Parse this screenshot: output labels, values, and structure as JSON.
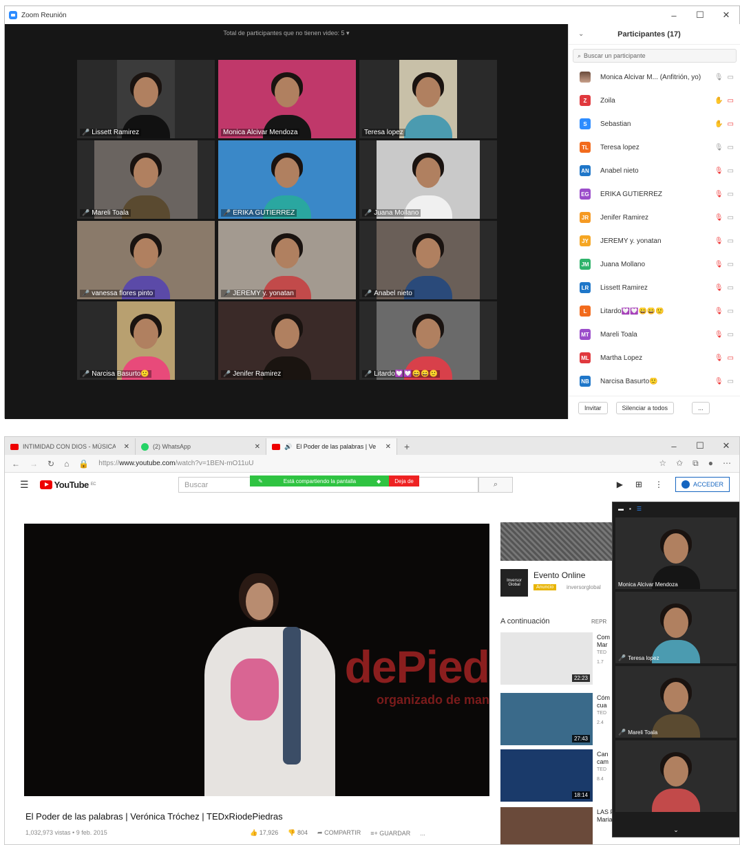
{
  "zoom": {
    "window_title": "Zoom Reunión",
    "window_buttons": [
      "–",
      "☐",
      "✕"
    ],
    "no_video_text": "Total de participantes que no tienen video: 5",
    "no_video_caret": "▾",
    "tiles": [
      {
        "name": "Lissett Ramirez",
        "muted": true,
        "bg": "#3b3b3b",
        "shirt": "#111"
      },
      {
        "name": "Monica Alcivar Mendoza",
        "muted": false,
        "active": true,
        "bg": "#c0386a",
        "shirt": "#151515"
      },
      {
        "name": "Teresa lopez",
        "muted": false,
        "bg": "#c8c0a8",
        "shirt": "#4b9bb0"
      },
      {
        "name": "Mareli Toala",
        "muted": true,
        "bg": "#6a6460",
        "shirt": "#5a4a30"
      },
      {
        "name": "ERIKA GUTIERREZ",
        "muted": true,
        "bg": "#3a88c8",
        "shirt": "#2aa7a0"
      },
      {
        "name": "Juana Mollano",
        "muted": true,
        "bg": "#c9c9c9",
        "shirt": "#f0f0f0"
      },
      {
        "name": "vanessa flores pinto",
        "muted": true,
        "bg": "#8a7a6a",
        "shirt": "#5b4aa8"
      },
      {
        "name": "JEREMY   y. yonatan",
        "muted": true,
        "bg": "#a39a90",
        "shirt": "#c24a4a"
      },
      {
        "name": "Anabel nieto",
        "muted": true,
        "bg": "#6a5f58",
        "shirt": "#2a4a7a"
      },
      {
        "name": "Narcisa Basurto🙂",
        "muted": true,
        "bg": "#b8a070",
        "shirt": "#e84a7a"
      },
      {
        "name": "Jenifer Ramirez",
        "muted": true,
        "bg": "#3a2a28",
        "shirt": "#1a1410"
      },
      {
        "name": "Litardo💟💟😄😄🙂",
        "muted": true,
        "bg": "#6a6a6a",
        "shirt": "#d8404a"
      }
    ],
    "participants": {
      "title": "Participantes (17)",
      "search_placeholder": "Buscar un participante",
      "list": [
        {
          "initials": "",
          "photo": true,
          "color": "#9a7a6a",
          "name": "Monica Alcivar M...  (Anfitrión, yo)",
          "mic": "gray",
          "cam": "gray"
        },
        {
          "initials": "Z",
          "color": "#e0393e",
          "name": "Zoila",
          "mic": "blue",
          "cam": "red"
        },
        {
          "initials": "S",
          "color": "#2d8cff",
          "name": "Sebastian",
          "mic": "blue",
          "cam": "red"
        },
        {
          "initials": "TL",
          "color": "#f26b1d",
          "name": "Teresa lopez",
          "mic": "gray",
          "cam": "gray"
        },
        {
          "initials": "AN",
          "color": "#1f77c9",
          "name": "Anabel nieto",
          "mic": "red",
          "cam": "gray"
        },
        {
          "initials": "EG",
          "color": "#9b4dca",
          "name": "ERIKA GUTIERREZ",
          "mic": "red",
          "cam": "gray"
        },
        {
          "initials": "JR",
          "color": "#f59a23",
          "name": "Jenifer Ramirez",
          "mic": "red",
          "cam": "gray"
        },
        {
          "initials": "JY",
          "color": "#f5a623",
          "name": "JEREMY   y. yonatan",
          "mic": "red",
          "cam": "gray"
        },
        {
          "initials": "JM",
          "color": "#2fb36b",
          "name": "Juana Mollano",
          "mic": "red",
          "cam": "gray"
        },
        {
          "initials": "LR",
          "color": "#1f77c9",
          "name": "Lissett Ramirez",
          "mic": "red",
          "cam": "gray"
        },
        {
          "initials": "L",
          "color": "#f26b1d",
          "name": "Litardo💟💟😄😄🙂",
          "mic": "red",
          "cam": "gray"
        },
        {
          "initials": "MT",
          "color": "#9b4dca",
          "name": "Mareli Toala",
          "mic": "red",
          "cam": "gray"
        },
        {
          "initials": "ML",
          "color": "#e0393e",
          "name": "Martha Lopez",
          "mic": "red",
          "cam": "red"
        },
        {
          "initials": "NB",
          "color": "#1f77c9",
          "name": "Narcisa Basurto🙂",
          "mic": "red",
          "cam": "gray"
        }
      ],
      "invite_label": "Invitar",
      "mute_all_label": "Silenciar a todos",
      "more_label": "..."
    }
  },
  "browser": {
    "tabs": [
      {
        "title": "INTIMIDAD CON DIOS - MÚSICA",
        "icon": "youtube-icon"
      },
      {
        "title": "(2) WhatsApp",
        "icon": "whatsapp-icon"
      },
      {
        "title": "El Poder de las palabras | Ve",
        "icon": "youtube-icon",
        "active": true
      }
    ],
    "new_tab": "+",
    "url_prefix": "https://",
    "url_domain": "www.youtube.com",
    "url_path": "/watch?v=1BEN-mO11uU",
    "window_buttons": [
      "–",
      "☐",
      "✕"
    ]
  },
  "youtube": {
    "logo_text": "YouTube",
    "logo_region": "EC",
    "search_placeholder": "Buscar",
    "share_text": "Está compartiendo la pantalla",
    "stop_share_text": "Deja de",
    "acceder_label": "ACCEDER",
    "stage_text": "dePied",
    "stage_sub": "organizado de man",
    "video_title": "El Poder de las palabras | Verónica Tróchez | TEDxRiodePiedras",
    "video_stats": "1,032,973 vistas • 9 feb. 2015",
    "likes": "17,926",
    "dislikes": "804",
    "share_label": "COMPARTIR",
    "save_label": "GUARDAR",
    "more_label": "...",
    "ad": {
      "logo_text": "Inversor Global",
      "title": "Evento Online",
      "badge": "Anuncio",
      "domain": "inversorglobal"
    },
    "next_label": "A continuación",
    "autoplay_label": "REPR",
    "related": [
      {
        "title": "Com\nMar",
        "channel": "TED",
        "views": "1.7",
        "duration": "22:23",
        "thumb": "#e6e6e6"
      },
      {
        "title": "Cóm\ncua",
        "channel": "TED",
        "views": "2.4",
        "duration": "27:43",
        "thumb": "#3a6a8a"
      },
      {
        "title": "Can\ncam",
        "channel": "TED",
        "views": "8.4",
        "duration": "18:14",
        "thumb": "#1a3a6a"
      },
      {
        "title": "LAS PALABRAS NOS DEFINEN |\nMaria del Pilar Montes de Oca...",
        "channel": "",
        "views": "",
        "duration": "",
        "thumb": "#6a4a3a"
      }
    ]
  },
  "mini_zoom": {
    "tiles": [
      {
        "name": "Monica Alcivar Mendoza",
        "muted": false,
        "bg": "#c0386a",
        "shirt": "#151515"
      },
      {
        "name": "Teresa lopez",
        "muted": true,
        "bg": "#c8c0a8",
        "shirt": "#4b9bb0"
      },
      {
        "name": "Mareli Toala",
        "muted": true,
        "bg": "#6a6460",
        "shirt": "#5a4a30"
      },
      {
        "name": "",
        "muted": false,
        "bg": "#a39a90",
        "shirt": "#c24a4a"
      }
    ],
    "chevron": "⌄"
  }
}
